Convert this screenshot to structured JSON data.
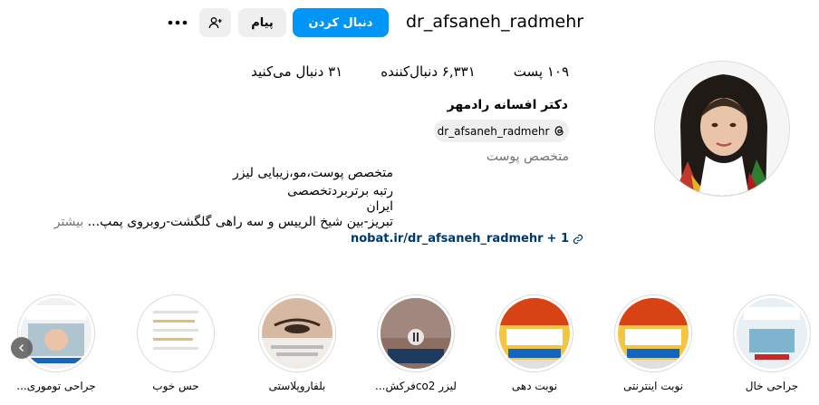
{
  "header": {
    "username": "dr_afsaneh_radmehr",
    "follow_label": "دنبال کردن",
    "message_label": "پیام",
    "add_user_icon": "person-add-icon",
    "more_icon": "more-options-icon"
  },
  "stats": {
    "posts": "۱۰۹ پست",
    "followers": "۶,۳۳۱ دنبال‌کننده",
    "following": "۳۱ دنبال می‌کنید"
  },
  "profile": {
    "full_name": "دکتر افسانه رادمهر",
    "threads_handle": "dr_afsaneh_radmehr",
    "category": "متخصص پوست",
    "bio_lines": [
      "متخصص پوست،مو،زیبایی لیزر",
      "رتبه برتربردتخصصی",
      "ایران"
    ],
    "address_line": "تبریز-بین شیخ الرییس و سه راهی گلگشت-روبروی پمپ...",
    "more_label": "بیشتر",
    "link": "nobat.ir/dr_afsaneh_radmehr",
    "link_extra": "+ 1"
  },
  "highlights": [
    {
      "label": "جراحی خال"
    },
    {
      "label": "نوبت اینترنتی"
    },
    {
      "label": "نوبت دهی"
    },
    {
      "label": "لیزر co2فرکش..."
    },
    {
      "label": "بلفاروپلاستی"
    },
    {
      "label": "حس خوب"
    },
    {
      "label": "جراحی توموری..."
    }
  ],
  "colors": {
    "accent": "#0095f6",
    "secondary_button": "#efefef",
    "link": "#00376b",
    "muted_text": "#737373"
  }
}
